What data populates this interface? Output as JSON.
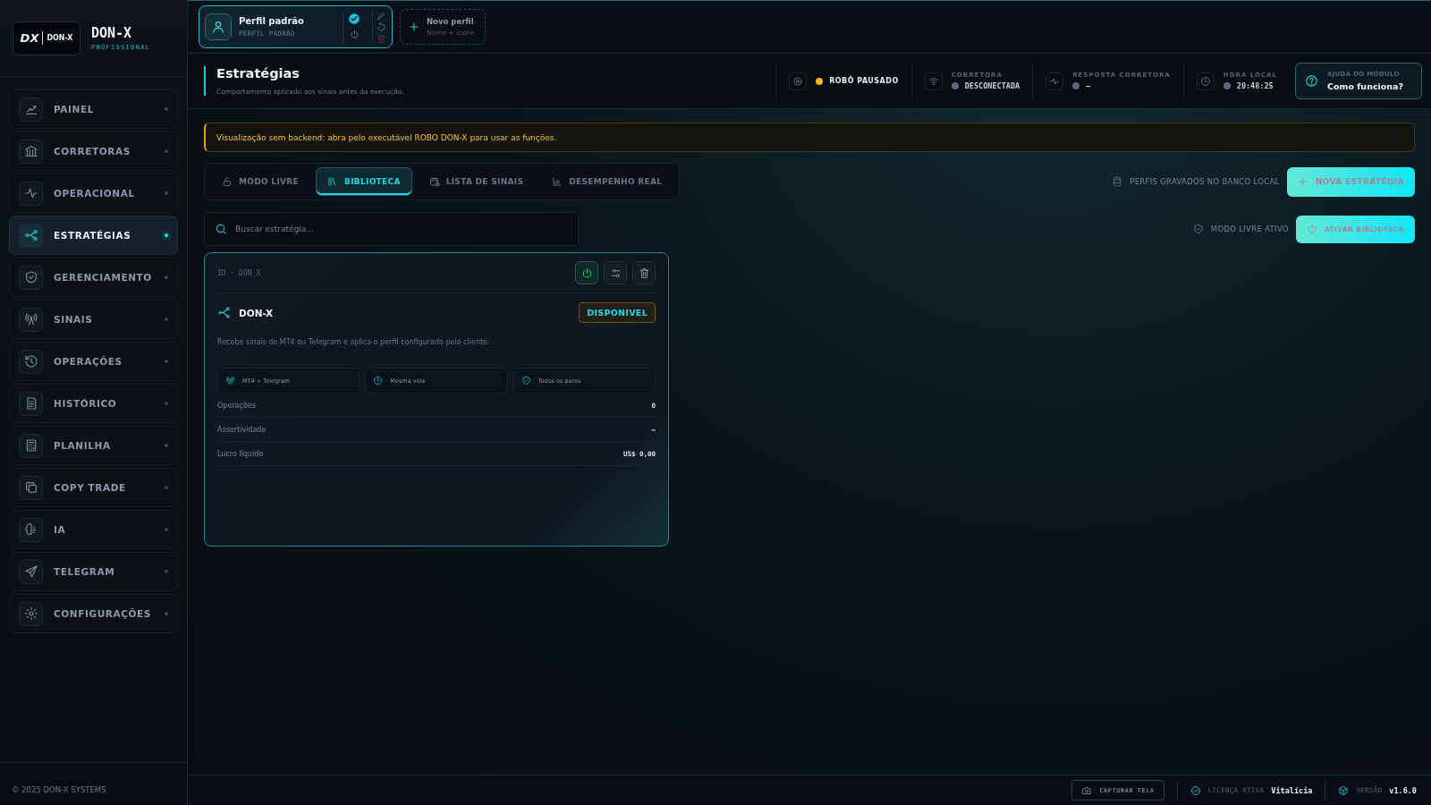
{
  "sidebar": {
    "logo": {
      "mark": "DX",
      "text": "DON-X"
    },
    "brand": "DON-X",
    "edition": "PROFISSIONAL",
    "items": [
      {
        "label": "PAINEL",
        "selected": false
      },
      {
        "label": "CORRETORAS",
        "selected": false
      },
      {
        "label": "OPERACIONAL",
        "selected": false
      },
      {
        "label": "ESTRATÉGIAS",
        "selected": true
      },
      {
        "label": "GERENCIAMENTO",
        "selected": false
      },
      {
        "label": "SINAIS",
        "selected": false
      },
      {
        "label": "OPERAÇÕES",
        "selected": false
      },
      {
        "label": "HISTÓRICO",
        "selected": false
      },
      {
        "label": "PLANILHA",
        "selected": false
      },
      {
        "label": "COPY TRADE",
        "selected": false
      },
      {
        "label": "IA",
        "selected": false
      },
      {
        "label": "TELEGRAM",
        "selected": false
      },
      {
        "label": "CONFIGURAÇÕES",
        "selected": false
      }
    ],
    "footer": "© 2025 DON-X SYSTEMS"
  },
  "profiles": {
    "items": [
      {
        "name": "Perfil padrão",
        "subtitle": "PERFIL PADRÃO",
        "active": true
      }
    ],
    "new_profile": {
      "label": "Novo perfil",
      "hint": "Nome + ícone"
    }
  },
  "header": {
    "title": "Estratégias",
    "subtitle": "Comportamento aplicado aos sinais antes da execução.",
    "status": [
      {
        "kind": "robot",
        "value": "ROBÔ PAUSADO",
        "color": "#f5b50a"
      },
      {
        "kind": "broker",
        "label": "CORRETORA",
        "value": "DESCONECTADA",
        "color": "#5b6578"
      },
      {
        "kind": "response",
        "label": "RESPOSTA CORRETORA",
        "value": "–",
        "color": "#5b6578"
      },
      {
        "kind": "clock",
        "label": "HORA LOCAL",
        "value": "20:48:25",
        "color": "#5b6578"
      }
    ],
    "help": {
      "label": "AJUDA DO MÓDULO",
      "value": "Como funciona?"
    }
  },
  "alert": "Visualização sem backend: abra pelo executável ROBO DON-X para usar as funções.",
  "tabs": [
    {
      "label": "MODO LIVRE",
      "selected": false
    },
    {
      "label": "BIBLIOTECA",
      "selected": true
    },
    {
      "label": "LISTA DE SINAIS",
      "selected": false
    },
    {
      "label": "DESEMPENHO REAL",
      "selected": false
    }
  ],
  "storage_note": "PERFIS GRAVADOS NO BANCO LOCAL",
  "new_strategy_button": "NOVA ESTRATÉGIA",
  "mode_note": "MODO LIVRE ATIVO",
  "activate_button": "ATIVAR BIBLIOTECA",
  "search": {
    "placeholder": "Buscar estratégia..."
  },
  "strategies": [
    {
      "id": "ID · DON_X",
      "name": "DON-X",
      "badge": "DISPONIVEL",
      "enabled": true,
      "description": "Recebe sinais do MT4 ou Telegram e aplica o perfil configurado pelo cliente.",
      "chips": [
        "MT4 + Telegram",
        "Mesma vela",
        "Todos os pares"
      ],
      "stats": [
        {
          "label": "Operações",
          "value": "0"
        },
        {
          "label": "Assertividade",
          "value": "–"
        },
        {
          "label": "Lucro líquido",
          "value": "US$ 0,00"
        }
      ]
    }
  ],
  "status_bar": {
    "capture_button": "CAPTURAR TELA",
    "license_label": "LICENÇA ATIVA",
    "license_value": "Vitalícia",
    "version_label": "VERSÃO",
    "version_value": "v1.6.0"
  }
}
